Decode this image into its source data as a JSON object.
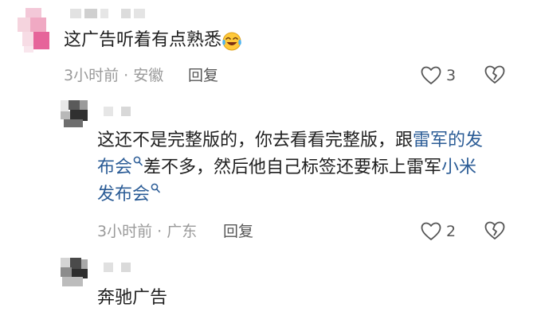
{
  "comments": [
    {
      "text": "这广告听着有点熟悉",
      "emoji": "laughing-crying-emoji",
      "meta": "3小时前 · 安徽",
      "reply_label": "回复",
      "likes": "3"
    },
    {
      "text_part1": "这还不是完整版的，你去看看完整版，跟",
      "link1_part1": "雷军的发",
      "link1_part2": "布会",
      "text_part2": "差不多，然后他自己标签还要标上雷军",
      "link2_part1": "小米",
      "link2_part2": "发布会",
      "meta": "3小时前 · 广东",
      "reply_label": "回复",
      "likes": "2"
    },
    {
      "text": "奔驰广告"
    }
  ],
  "colors": {
    "link": "#2b5c96",
    "meta": "#9a9a9a",
    "text": "#1f1f1f"
  }
}
